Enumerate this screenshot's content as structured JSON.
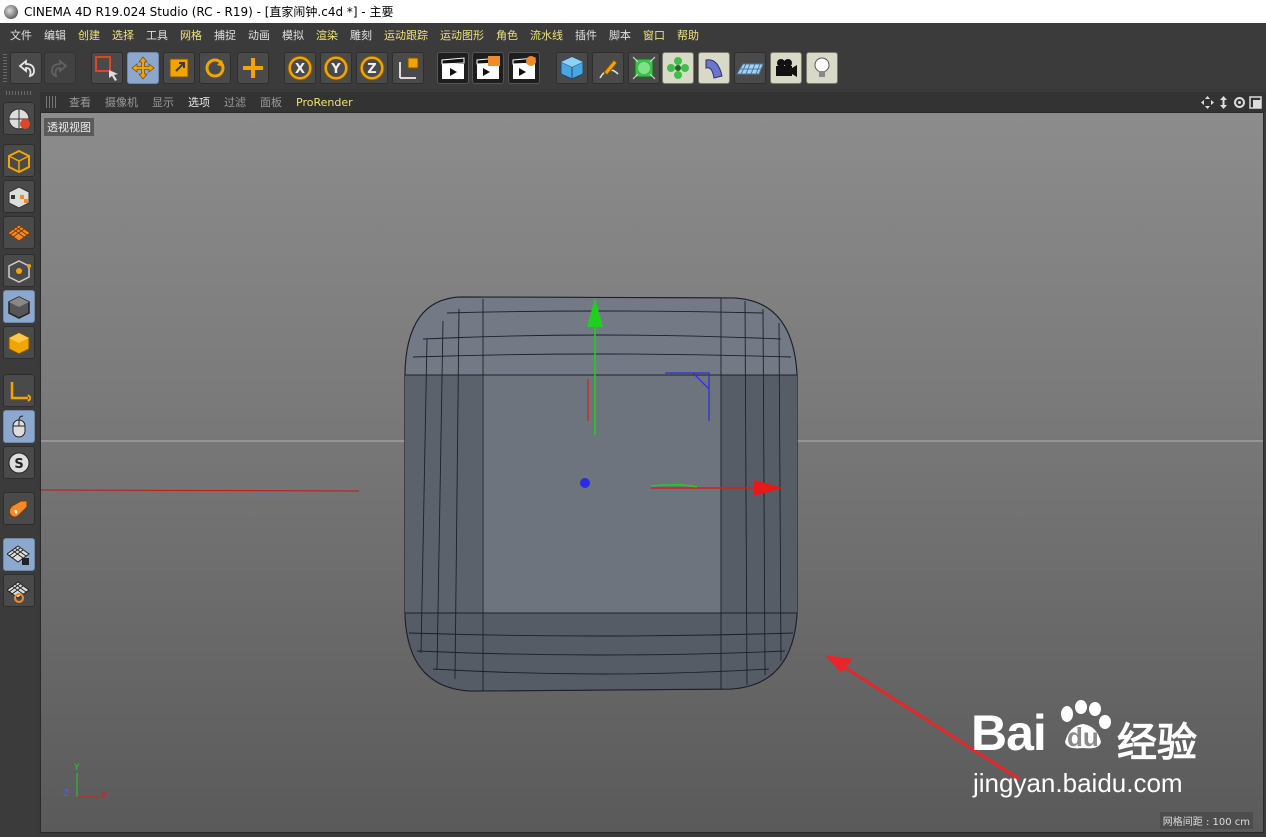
{
  "window": {
    "title": "CINEMA 4D R19.024 Studio (RC - R19) - [直家闹钟.c4d *] - 主要"
  },
  "menu": [
    "文件",
    "编辑",
    "创建",
    "选择",
    "工具",
    "网格",
    "捕捉",
    "动画",
    "模拟",
    "渲染",
    "雕刻",
    "运动跟踪",
    "运动图形",
    "角色",
    "流水线",
    "插件",
    "脚本",
    "窗口",
    "帮助"
  ],
  "viewport_menu": [
    "查看",
    "摄像机",
    "显示",
    "选项",
    "过滤",
    "面板",
    "ProRender"
  ],
  "viewport": {
    "label": "透视视图",
    "grid_spacing": "网格间距 : 100 cm",
    "axis_y": "Y",
    "axis_z": "Z",
    "axis_x": "X"
  },
  "watermark": {
    "brand": "Bai",
    "brand2": "du",
    "cn": "经验",
    "url": "jingyan.baidu.com"
  },
  "colors": {
    "accent": "#f0e27a",
    "selected": "#8da8cf",
    "arrow": "#e8262a"
  }
}
